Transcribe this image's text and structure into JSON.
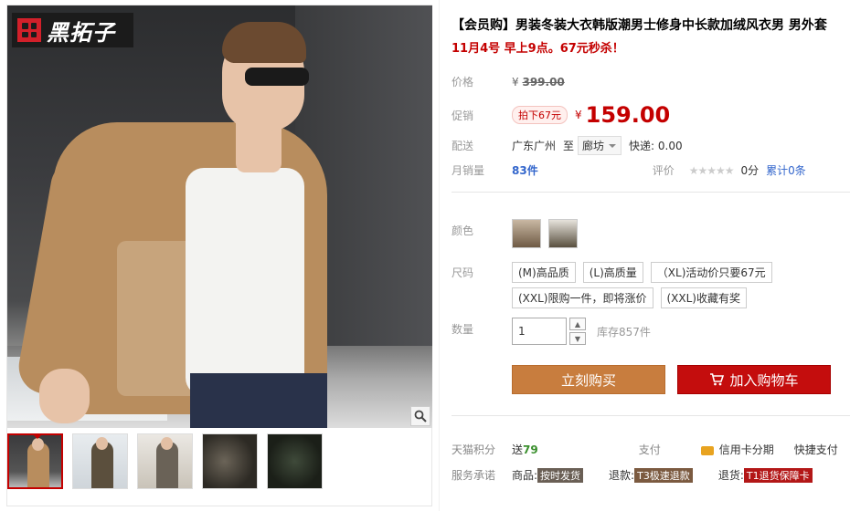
{
  "brand": {
    "logo_text": "黑拓子"
  },
  "product": {
    "title": "【会员购】男装冬装大衣韩版潮男士修身中长款加绒风衣男 男外套",
    "subtitle": "11月4号 早上9点。67元秒杀！"
  },
  "price": {
    "label": "价格",
    "currency": "¥",
    "original": "399.00",
    "promo_label": "促销",
    "promo_tag": "拍下67元",
    "promo_price": "159.00"
  },
  "shipping": {
    "label": "配送",
    "from": "广东广州",
    "to_word": "至",
    "to_city": "廊坊",
    "fee": "快递: 0.00"
  },
  "sales": {
    "label": "月销量",
    "count": "83",
    "unit": "件",
    "rating_label": "评价",
    "stars": "★★★★★",
    "score": "0分",
    "total_reviews": "累计0条"
  },
  "options": {
    "color_label": "颜色",
    "size_label": "尺码",
    "sizes_row1": [
      "(M)高品质",
      "(L)高质量",
      "（XL)活动价只要67元"
    ],
    "sizes_row2": [
      "(XXL)限购一件，即将涨价",
      "(XXL)收藏有奖"
    ]
  },
  "quantity": {
    "label": "数量",
    "value": "1",
    "stock": "库存857件",
    "up": "▲",
    "down": "▼"
  },
  "actions": {
    "buy_now": "立刻购买",
    "add_to_cart": "加入购物车"
  },
  "footer": {
    "points_label": "天猫积分",
    "points_prefix": "送",
    "points_value": "79",
    "pay_label": "支付",
    "credit_installment": "信用卡分期",
    "quick_pay": "快捷支付",
    "service_label": "服务承诺",
    "goods_prefix": "商品:",
    "goods_tag": "按时发货",
    "refund_prefix": "退款:",
    "refund_tag": "T3极速退款",
    "return_prefix": "退货:",
    "return_tag": "T1退货保障卡"
  },
  "colors": {
    "accent_red": "#c40000",
    "buy_orange": "#c87d3e",
    "cart_red": "#c40d0d",
    "link_blue": "#3366cc"
  }
}
